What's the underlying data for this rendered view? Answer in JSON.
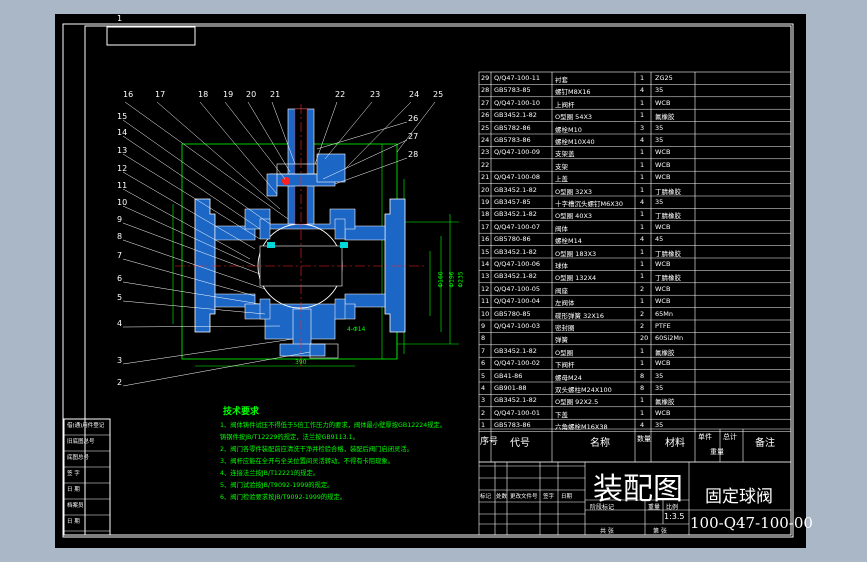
{
  "sheet": {
    "title": "装配图",
    "name": "固定球阀",
    "drawing_no": "100-Q47-100-00",
    "scale": "1:3.5"
  },
  "title_block": {
    "labels": [
      "标记",
      "处数",
      "更改文件号",
      "签字",
      "日期"
    ],
    "stage_label": "阶段标记",
    "weight_label": "重量",
    "scale_label": "比例",
    "sheet_label": "共 张",
    "sheet_no_label": "第 张"
  },
  "left_strip": [
    "借(通)用件登记",
    "旧底图总号",
    "底图总号",
    "签 字",
    "日 期",
    "档案员",
    "日 期"
  ],
  "bom_header": {
    "no": "序号",
    "code": "代号",
    "name": "名称",
    "qty": "数量",
    "material": "材料",
    "unit_weight": "单件",
    "total_weight": "总计",
    "weight": "重量",
    "remarks": "备注"
  },
  "bom": [
    {
      "no": "29",
      "code": "Q/Q47-100-11",
      "name": "衬套",
      "qty": "1",
      "material": "ZG25"
    },
    {
      "no": "28",
      "code": "GB5783-85",
      "name": "螺钉M8X16",
      "qty": "4",
      "material": "35"
    },
    {
      "no": "27",
      "code": "Q/Q47-100-10",
      "name": "上阀杆",
      "qty": "1",
      "material": "WCB"
    },
    {
      "no": "26",
      "code": "GB3452.1-82",
      "name": "O型圈 54X3",
      "qty": "1",
      "material": "氟橡胶"
    },
    {
      "no": "25",
      "code": "GB5782-86",
      "name": "螺栓M10",
      "qty": "3",
      "material": "35"
    },
    {
      "no": "24",
      "code": "GB5783-86",
      "name": "螺栓M10X40",
      "qty": "4",
      "material": "35"
    },
    {
      "no": "23",
      "code": "Q/Q47-100-09",
      "name": "支架盖",
      "qty": "1",
      "material": "WCB"
    },
    {
      "no": "22",
      "code": "",
      "name": "支架",
      "qty": "1",
      "material": "WCB"
    },
    {
      "no": "21",
      "code": "Q/Q47-100-08",
      "name": "上盖",
      "qty": "1",
      "material": "WCB"
    },
    {
      "no": "20",
      "code": "GB3452.1-82",
      "name": "O型圈 32X3",
      "qty": "1",
      "material": "丁腈橡胶"
    },
    {
      "no": "19",
      "code": "GB3457-85",
      "name": "十字槽沉头螺钉M6X30",
      "qty": "4",
      "material": "35"
    },
    {
      "no": "18",
      "code": "GB3452.1-82",
      "name": "O型圈 40X3",
      "qty": "1",
      "material": "丁腈橡胶"
    },
    {
      "no": "17",
      "code": "Q/Q47-100-07",
      "name": "阀体",
      "qty": "1",
      "material": "WCB"
    },
    {
      "no": "16",
      "code": "GB5780-86",
      "name": "螺栓M14",
      "qty": "4",
      "material": "45"
    },
    {
      "no": "15",
      "code": "GB3452.1-82",
      "name": "O型圈 183X3",
      "qty": "1",
      "material": "丁腈橡胶"
    },
    {
      "no": "14",
      "code": "Q/Q47-100-06",
      "name": "球体",
      "qty": "1",
      "material": "WCB"
    },
    {
      "no": "13",
      "code": "GB3452.1-82",
      "name": "O型圈 132X4",
      "qty": "1",
      "material": "丁腈橡胶"
    },
    {
      "no": "12",
      "code": "Q/Q47-100-05",
      "name": "阀座",
      "qty": "2",
      "material": "WCB"
    },
    {
      "no": "11",
      "code": "Q/Q47-100-04",
      "name": "左阀体",
      "qty": "1",
      "material": "WCB"
    },
    {
      "no": "10",
      "code": "GB5780-85",
      "name": "碟形弹簧 32X16",
      "qty": "2",
      "material": "65Mn"
    },
    {
      "no": "9",
      "code": "Q/Q47-100-03",
      "name": "密封圈",
      "qty": "2",
      "material": "PTFE"
    },
    {
      "no": "8",
      "code": "",
      "name": "弹簧",
      "qty": "20",
      "material": "60Si2Mn"
    },
    {
      "no": "7",
      "code": "GB3452.1-82",
      "name": "O型圈",
      "qty": "1",
      "material": "氟橡胶"
    },
    {
      "no": "6",
      "code": "Q/Q47-100-02",
      "name": "下阀杆",
      "qty": "1",
      "material": "WCB"
    },
    {
      "no": "5",
      "code": "GB41-86",
      "name": "螺母M24",
      "qty": "8",
      "material": "35"
    },
    {
      "no": "4",
      "code": "GB901-88",
      "name": "双头螺柱M24X100",
      "qty": "8",
      "material": "35"
    },
    {
      "no": "3",
      "code": "GB3452.1-82",
      "name": "O型圈 92X2.5",
      "qty": "1",
      "material": "氟橡胶"
    },
    {
      "no": "2",
      "code": "Q/Q47-100-01",
      "name": "下盖",
      "qty": "1",
      "material": "WCB"
    },
    {
      "no": "1",
      "code": "GB5783-86",
      "name": "六角螺栓M16X38",
      "qty": "4",
      "material": "35"
    }
  ],
  "notes": {
    "title": "技术要求",
    "lines": [
      "1、阀体铸件试压不得低于5倍工作压力的要求，阀体最小壁厚按GB12224规定。",
      "   铸钢件按JB/T12229的规定，法兰按GB9113.1。",
      "2、阀门各零件装配前应清洗干净并检验合格，装配后阀门启闭灵活。",
      "3、阀杆应能在全开与全关位置间灵活转动，不得有卡阻现象。",
      "4、连接法兰按JB/T12221的规定。",
      "5、阀门试验按JB/T9092-1999的规定。",
      "6、阀门检验要求按JB/T9092-1999的规定。"
    ]
  },
  "balloons": [
    "16",
    "17",
    "18",
    "19",
    "20",
    "21",
    "22",
    "23",
    "24",
    "25",
    "15",
    "14",
    "13",
    "12",
    "11",
    "10",
    "9",
    "8",
    "7",
    "6",
    "5",
    "4",
    "3",
    "2",
    "1",
    "26",
    "27",
    "28"
  ],
  "dimensions": [
    "Φ160",
    "Φ196",
    "Φ235",
    "4-Φ14",
    "390"
  ],
  "colors": {
    "frame": "#ffffff",
    "outline": "#ffffff",
    "notes_text": "#00ff00",
    "dimension": "#00ff00",
    "center_line": "#ff2020",
    "section_fill": "#1c66c6",
    "accent": "#00d8d8",
    "background": "#000000",
    "canvas_backdrop": "#a9b7c6"
  }
}
